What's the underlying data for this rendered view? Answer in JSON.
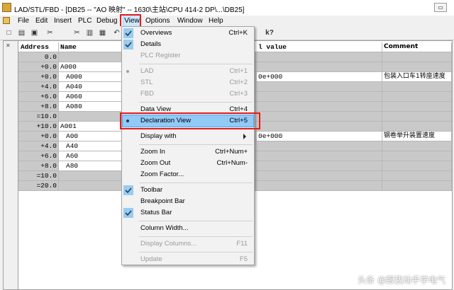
{
  "window": {
    "title": "LAD/STL/FBD  - [DB25 -- \"AO 映射\" -- 1630\\主站\\CPU 414-2 DP\\...\\DB25]",
    "restore_glyph": "▭"
  },
  "menubar": {
    "items": [
      {
        "label": "File"
      },
      {
        "label": "Edit"
      },
      {
        "label": "Insert"
      },
      {
        "label": "PLC"
      },
      {
        "label": "Debug"
      },
      {
        "label": "View"
      },
      {
        "label": "Options"
      },
      {
        "label": "Window"
      },
      {
        "label": "Help"
      }
    ]
  },
  "toolbar": {
    "buttons": [
      "□",
      "▤",
      "▣",
      "✂",
      "▥",
      "▦",
      "↶"
    ],
    "help_button": "k?"
  },
  "table": {
    "headers": {
      "address": "Address",
      "name": "Name",
      "initial_value": "l value",
      "comment": "Comment"
    },
    "rows": [
      {
        "address": "0.0",
        "name": "",
        "init": "",
        "comment": ""
      },
      {
        "address": "+0.0",
        "name": "A000",
        "init": "",
        "comment": ""
      },
      {
        "address": "+0.0",
        "name": "A000",
        "init": "0e+000",
        "comment": "包装入口车1转座速度"
      },
      {
        "address": "+4.0",
        "name": "A040",
        "init": "",
        "comment": ""
      },
      {
        "address": "+6.0",
        "name": "A060",
        "init": "",
        "comment": ""
      },
      {
        "address": "+8.0",
        "name": "A080",
        "init": "",
        "comment": ""
      },
      {
        "address": "=10.0",
        "name": "",
        "init": "",
        "comment": ""
      },
      {
        "address": "+10.0",
        "name": "A001",
        "init": "",
        "comment": ""
      },
      {
        "address": "+0.0",
        "name": "A00",
        "init": "0e+000",
        "comment": "钢卷举升装置速度"
      },
      {
        "address": "+4.0",
        "name": "A40",
        "init": "",
        "comment": ""
      },
      {
        "address": "+6.0",
        "name": "A60",
        "init": "",
        "comment": ""
      },
      {
        "address": "+8.0",
        "name": "A80",
        "init": "",
        "comment": ""
      },
      {
        "address": "=10.0",
        "name": "",
        "init": "",
        "comment": ""
      },
      {
        "address": "=20.0",
        "name": "",
        "init": "",
        "comment": ""
      }
    ]
  },
  "view_menu": {
    "items": [
      {
        "label": "Overviews",
        "shortcut": "Ctrl+K"
      },
      {
        "label": "Details",
        "shortcut": ""
      },
      {
        "label": "PLC Register",
        "shortcut": ""
      },
      {
        "label": "LAD",
        "shortcut": "Ctrl+1"
      },
      {
        "label": "STL",
        "shortcut": "Ctrl+2"
      },
      {
        "label": "FBD",
        "shortcut": "Ctrl+3"
      },
      {
        "label": "Data View",
        "shortcut": "Ctrl+4"
      },
      {
        "label": "Declaration View",
        "shortcut": "Ctrl+5"
      },
      {
        "label": "Display with",
        "shortcut": ""
      },
      {
        "label": "Zoom In",
        "shortcut": "Ctrl+Num+"
      },
      {
        "label": "Zoom Out",
        "shortcut": "Ctrl+Num-"
      },
      {
        "label": "Zoom Factor...",
        "shortcut": ""
      },
      {
        "label": "Toolbar",
        "shortcut": ""
      },
      {
        "label": "Breakpoint Bar",
        "shortcut": ""
      },
      {
        "label": "Status Bar",
        "shortcut": ""
      },
      {
        "label": "Column Width...",
        "shortcut": ""
      },
      {
        "label": "Display Columns...",
        "shortcut": "F11"
      },
      {
        "label": "Update",
        "shortcut": "F5"
      }
    ]
  },
  "watermark": "头条 @跟我动手学电气",
  "colors": {
    "highlight": "#91c9f7",
    "check_bg": "#99ccee",
    "annotation_red": "#e31b1b",
    "row_shade": "#c9c9c9"
  }
}
